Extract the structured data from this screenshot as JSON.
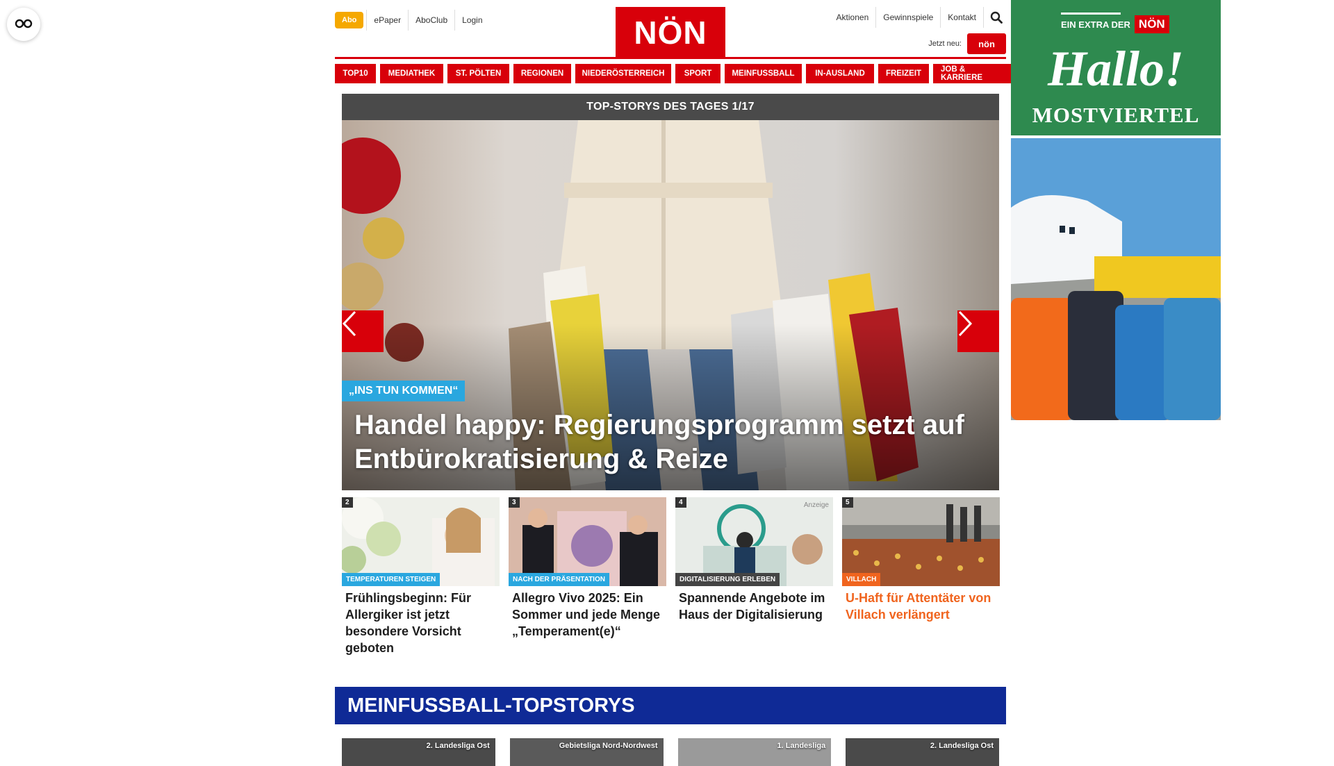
{
  "colors": {
    "brand_red": "#d8000a",
    "abo_orange": "#f5a800",
    "tag_blue": "#2aa7df",
    "tag_orange": "#f0641e",
    "fussball_blue": "#0f2a96",
    "ad_green": "#2e8a4f"
  },
  "topnav": {
    "abo": "Abo",
    "epaper": "ePaper",
    "aboclub": "AboClub",
    "login": "Login"
  },
  "logo": "NÖN",
  "rightnav": {
    "aktionen": "Aktionen",
    "gewinnspiele": "Gewinnspiele",
    "kontakt": "Kontakt",
    "search_icon": "search-icon"
  },
  "jetzt_neu": {
    "label": "Jetzt neu:",
    "badge": "nön"
  },
  "categories": [
    "TOP10",
    "MEDIATHEK",
    "ST. PÖLTEN",
    "REGIONEN",
    "NIEDERÖSTERREICH",
    "SPORT",
    "MEINFUSSBALL",
    "IN-AUSLAND",
    "FREIZEIT",
    "JOB & KARRIERE"
  ],
  "hero": {
    "bar": "TOP-STORYS DES TAGES 1/17",
    "tag": "„INS TUN KOMMEN“",
    "title": "Handel happy: Regierungsprogramm setzt auf Entbürokratisierung & Reize",
    "prev_icon": "chevron-left-icon",
    "next_icon": "chevron-right-icon"
  },
  "teasers": [
    {
      "num": "2",
      "tag": "TEMPERATUREN STEIGEN",
      "tag_color": "#2aa7df",
      "title": "Frühlingsbeginn: Für Allergiker ist jetzt besondere Vorsicht geboten",
      "orange": false
    },
    {
      "num": "3",
      "tag": "NACH DER PRÄSENTATION",
      "tag_color": "#2aa7df",
      "title": "Allegro Vivo 2025: Ein Sommer und jede Menge „Temperament(e)“",
      "orange": false
    },
    {
      "num": "4",
      "tag": "DIGITALISIERUNG ERLEBEN",
      "tag_color": "#444444",
      "title": "Spannende Angebote im Haus der Digitalisierung",
      "anzeige": "Anzeige",
      "orange": false
    },
    {
      "num": "5",
      "tag": "VILLACH",
      "tag_color": "#f0641e",
      "title": "U-Haft für Attentäter von Villach verlängert",
      "orange": true
    }
  ],
  "fussball": {
    "header": "MEINFUSSBALL-TOPSTORYS",
    "cards": [
      "2. Landesliga Ost",
      "Gebietsliga Nord-Nordwest",
      "1. Landesliga",
      "2. Landesliga Ost"
    ]
  },
  "ad": {
    "extra": "EIN EXTRA DER",
    "n": "NÖN",
    "hallo": "Hallo!",
    "most": "MOSTVIERTEL"
  }
}
